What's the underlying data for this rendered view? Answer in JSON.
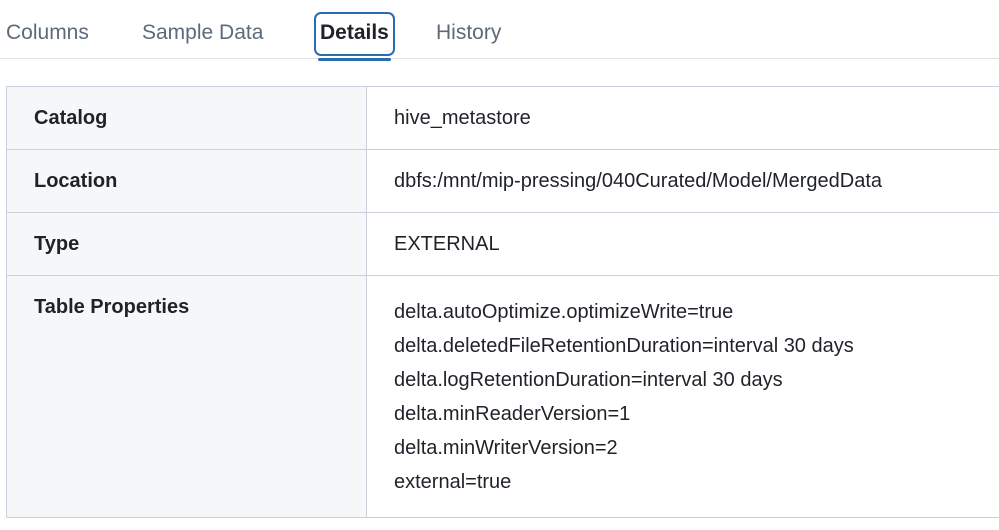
{
  "tabs": [
    {
      "label": "Columns",
      "active": false
    },
    {
      "label": "Sample Data",
      "active": false
    },
    {
      "label": "Details",
      "active": true
    },
    {
      "label": "History",
      "active": false
    }
  ],
  "details": {
    "catalog": {
      "key": "Catalog",
      "value": "hive_metastore"
    },
    "location": {
      "key": "Location",
      "value": "dbfs:/mnt/mip-pressing/040Curated/Model/MergedData"
    },
    "type": {
      "key": "Type",
      "value": "EXTERNAL"
    },
    "table_properties": {
      "key": "Table Properties",
      "values": [
        "delta.autoOptimize.optimizeWrite=true",
        "delta.deletedFileRetentionDuration=interval 30 days",
        "delta.logRetentionDuration=interval 30 days",
        "delta.minReaderVersion=1",
        "delta.minWriterVersion=2",
        "external=true"
      ]
    }
  },
  "colors": {
    "accent": "#2b6cb0",
    "tab_inactive": "#5d6a7a",
    "key_background": "#f5f7f9",
    "border": "#c9d2dc"
  }
}
